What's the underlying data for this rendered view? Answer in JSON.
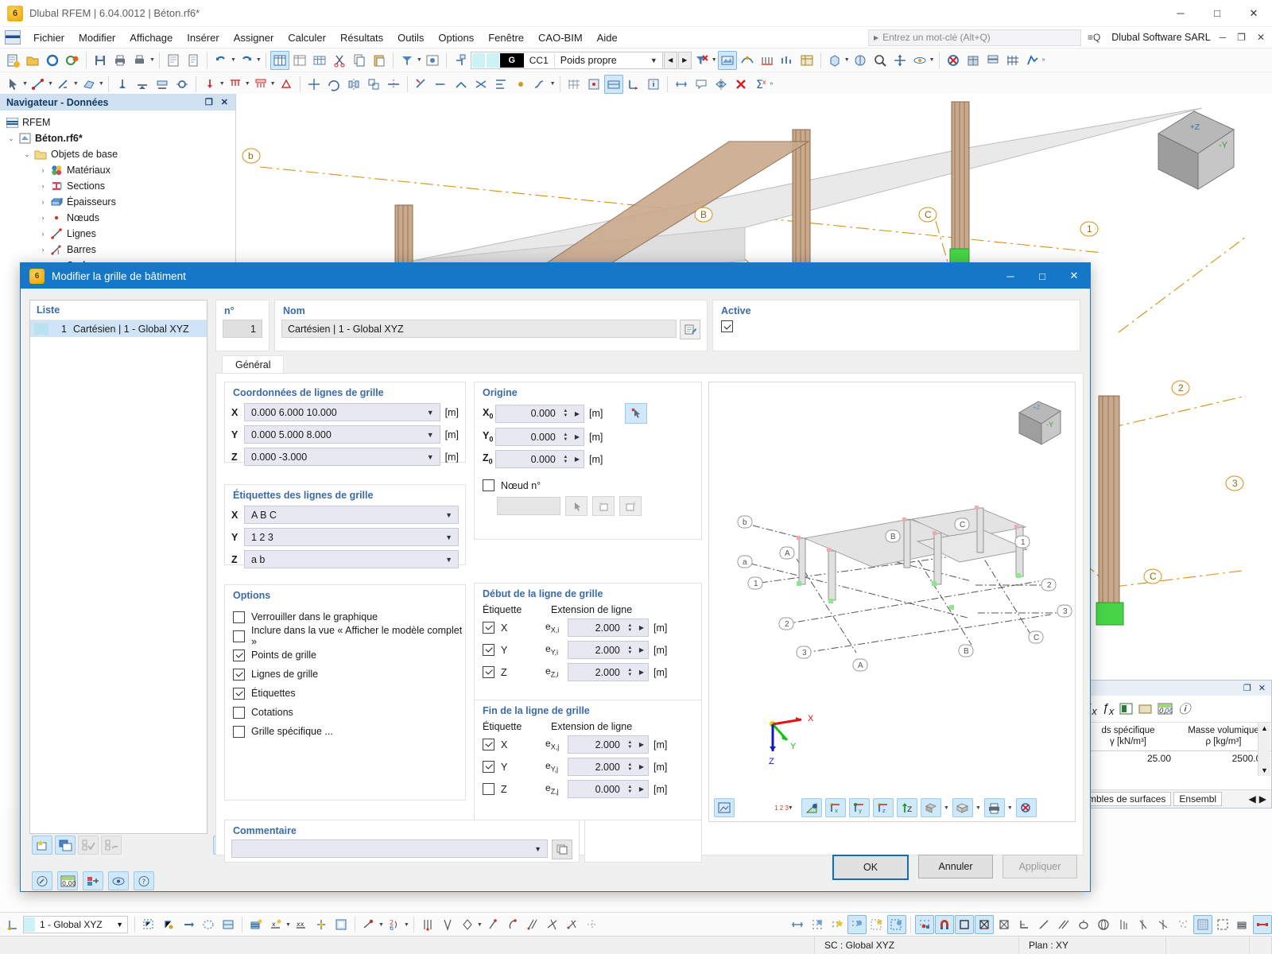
{
  "window": {
    "title": "Dlubal RFEM | 6.04.0012 | Béton.rf6*",
    "icon": "rfem-app-icon",
    "minimize": "─",
    "maximize": "□",
    "close": "✕"
  },
  "menubar": {
    "items": [
      "Fichier",
      "Modifier",
      "Affichage",
      "Insérer",
      "Assigner",
      "Calculer",
      "Résultats",
      "Outils",
      "Options",
      "Fenêtre",
      "CAO-BIM",
      "Aide"
    ],
    "search_placeholder": "Entrez un mot-clé (Alt+Q)",
    "brand": "Dlubal Software SARL"
  },
  "toolbar": {
    "load_case": {
      "tag": "G",
      "code": "CC1",
      "name": "Poids propre"
    }
  },
  "navigator": {
    "title": "Navigateur - Données",
    "restore_icon": "restore-icon",
    "close_icon": "close-icon",
    "tree": [
      {
        "label": "RFEM",
        "indent": 0,
        "twisty": "",
        "icon": "rfem-icon",
        "bold": false
      },
      {
        "label": "Béton.rf6*",
        "indent": 1,
        "twisty": "⌄",
        "icon": "model-icon",
        "bold": true
      },
      {
        "label": "Objets de base",
        "indent": 2,
        "twisty": "⌄",
        "icon": "folder-icon",
        "bold": false
      },
      {
        "label": "Matériaux",
        "indent": 3,
        "twisty": "›",
        "icon": "materials-icon",
        "bold": false
      },
      {
        "label": "Sections",
        "indent": 3,
        "twisty": "›",
        "icon": "sections-icon",
        "bold": false
      },
      {
        "label": "Épaisseurs",
        "indent": 3,
        "twisty": "›",
        "icon": "thickness-icon",
        "bold": false
      },
      {
        "label": "Nœuds",
        "indent": 3,
        "twisty": "›",
        "icon": "node-icon",
        "bold": false
      },
      {
        "label": "Lignes",
        "indent": 3,
        "twisty": "›",
        "icon": "line-icon",
        "bold": false
      },
      {
        "label": "Barres",
        "indent": 3,
        "twisty": "›",
        "icon": "member-icon",
        "bold": false
      },
      {
        "label": "Surfaces",
        "indent": 3,
        "twisty": "›",
        "icon": "surface-icon",
        "bold": false
      }
    ]
  },
  "right_panel": {
    "restore_icon": "restore-icon",
    "close_icon": "close-icon",
    "columns": [
      "ds spécifique\nγ [kN/m³]",
      "Masse volumique\nρ [kg/m³]"
    ],
    "col1_line1": "ds spécifique",
    "col1_line2": "γ [kN/m³]",
    "col2_line1": "Masse volumique",
    "col2_line2": "ρ [kg/m³]",
    "row": [
      "25.00",
      "2500.00"
    ],
    "tabs": [
      "mbles de surfaces",
      "Ensembl"
    ]
  },
  "statusbar": {
    "coordinate_system": "SC : Global XYZ",
    "plane": "Plan : XY",
    "combo_value": "1 - Global XYZ"
  },
  "dialog": {
    "title": "Modifier la grille de bâtiment",
    "icon": "grid-dialog-icon",
    "minimize": "─",
    "maximize": "□",
    "close": "✕",
    "list": {
      "header": "Liste",
      "rows": [
        {
          "num": "1",
          "label": "Cartésien | 1 - Global XYZ"
        }
      ]
    },
    "number": {
      "label": "n°",
      "value": "1"
    },
    "name": {
      "label": "Nom",
      "value": "Cartésien | 1 - Global XYZ",
      "edit_icon": "edit-name-icon"
    },
    "active": {
      "label": "Active",
      "checked": true
    },
    "tabs": [
      {
        "label": "Général",
        "active": true
      }
    ],
    "grid_coordinates": {
      "title": "Coordonnées de lignes de grille",
      "unit": "[m]",
      "rows": [
        {
          "axis": "X",
          "value": "0.000 6.000 10.000"
        },
        {
          "axis": "Y",
          "value": "0.000 5.000 8.000"
        },
        {
          "axis": "Z",
          "value": "0.000 -3.000"
        }
      ]
    },
    "grid_labels": {
      "title": "Étiquettes des lignes de grille",
      "rows": [
        {
          "axis": "X",
          "value": "A B C"
        },
        {
          "axis": "Y",
          "value": "1 2 3"
        },
        {
          "axis": "Z",
          "value": "a b"
        }
      ]
    },
    "options": {
      "title": "Options",
      "items": [
        {
          "label": "Verrouiller dans le graphique",
          "checked": false
        },
        {
          "label": "Inclure dans la vue « Afficher le modèle complet »",
          "checked": false
        },
        {
          "label": "Points de grille",
          "checked": true
        },
        {
          "label": "Lignes de grille",
          "checked": true
        },
        {
          "label": "Étiquettes",
          "checked": true
        },
        {
          "label": "Cotations",
          "checked": false
        },
        {
          "label": "Grille spécifique ...",
          "checked": false
        }
      ]
    },
    "origin": {
      "title": "Origine",
      "unit": "[m]",
      "pick_icon": "pick-origin-icon",
      "rows": [
        {
          "label": "X",
          "sub": "0",
          "value": "0.000"
        },
        {
          "label": "Y",
          "sub": "0",
          "value": "0.000"
        },
        {
          "label": "Z",
          "sub": "0",
          "value": "0.000"
        }
      ],
      "node": {
        "label": "Nœud n°",
        "checked": false,
        "value": "",
        "icons": [
          "select-node-icon",
          "new-node-icon",
          "edit-node-icon"
        ]
      }
    },
    "grid_start": {
      "title": "Début de la ligne de grille",
      "col_label": "Étiquette",
      "col_ext": "Extension de ligne",
      "unit": "[m]",
      "rows": [
        {
          "axis": "X",
          "sym": "e",
          "sub": "X,i",
          "checked": true,
          "value": "2.000"
        },
        {
          "axis": "Y",
          "sym": "e",
          "sub": "Y,i",
          "checked": true,
          "value": "2.000"
        },
        {
          "axis": "Z",
          "sym": "e",
          "sub": "Z,i",
          "checked": true,
          "value": "2.000"
        }
      ]
    },
    "grid_end": {
      "title": "Fin de la ligne de grille",
      "col_label": "Étiquette",
      "col_ext": "Extension de ligne",
      "unit": "[m]",
      "rows": [
        {
          "axis": "X",
          "sym": "e",
          "sub": "X,j",
          "checked": true,
          "value": "2.000"
        },
        {
          "axis": "Y",
          "sym": "e",
          "sub": "Y,j",
          "checked": true,
          "value": "2.000"
        },
        {
          "axis": "Z",
          "sym": "e",
          "sub": "Z,j",
          "checked": false,
          "value": "0.000"
        }
      ]
    },
    "comment": {
      "title": "Commentaire",
      "value": "",
      "copy_icon": "copy-comment-icon"
    },
    "preview": {
      "axes": {
        "x": "X",
        "y": "Y",
        "z": "Z"
      },
      "grid_labels_left": [
        "b",
        "a",
        "1",
        "2",
        "3"
      ],
      "grid_labels_top": [
        "A",
        "B",
        "C"
      ],
      "grid_labels_right": [
        "1",
        "2",
        "3"
      ],
      "grid_labels_bottom": [
        "A",
        "B",
        "C"
      ],
      "view_cube": "view-cube",
      "toolbar_icons": [
        "render-mode-icon",
        "numbering-icon",
        "visibility-icon",
        "view-x-icon",
        "view-y-icon",
        "view-z-icon",
        "z-up-icon",
        "shading-icon",
        "box-icon",
        "print-icon",
        "reset-icon"
      ],
      "numbering_label": "1 2 3"
    },
    "list_toolbar": [
      "new-item-icon",
      "duplicate-item-icon",
      "check-all-icon",
      "toggle-check-icon",
      "delete-item-icon"
    ],
    "bottom_toolbar": [
      "info-icon",
      "units-icon",
      "settings-icon",
      "view-icon",
      "help-icon"
    ],
    "buttons": {
      "ok": "OK",
      "cancel": "Annuler",
      "apply": "Appliquer"
    }
  }
}
